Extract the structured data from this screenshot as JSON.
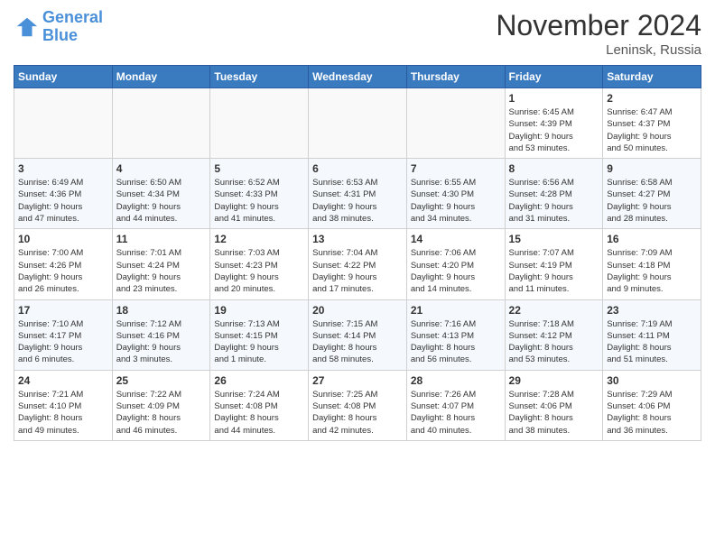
{
  "logo": {
    "line1": "General",
    "line2": "Blue"
  },
  "title": "November 2024",
  "location": "Leninsk, Russia",
  "days_of_week": [
    "Sunday",
    "Monday",
    "Tuesday",
    "Wednesday",
    "Thursday",
    "Friday",
    "Saturday"
  ],
  "weeks": [
    [
      {
        "day": "",
        "info": ""
      },
      {
        "day": "",
        "info": ""
      },
      {
        "day": "",
        "info": ""
      },
      {
        "day": "",
        "info": ""
      },
      {
        "day": "",
        "info": ""
      },
      {
        "day": "1",
        "info": "Sunrise: 6:45 AM\nSunset: 4:39 PM\nDaylight: 9 hours\nand 53 minutes."
      },
      {
        "day": "2",
        "info": "Sunrise: 6:47 AM\nSunset: 4:37 PM\nDaylight: 9 hours\nand 50 minutes."
      }
    ],
    [
      {
        "day": "3",
        "info": "Sunrise: 6:49 AM\nSunset: 4:36 PM\nDaylight: 9 hours\nand 47 minutes."
      },
      {
        "day": "4",
        "info": "Sunrise: 6:50 AM\nSunset: 4:34 PM\nDaylight: 9 hours\nand 44 minutes."
      },
      {
        "day": "5",
        "info": "Sunrise: 6:52 AM\nSunset: 4:33 PM\nDaylight: 9 hours\nand 41 minutes."
      },
      {
        "day": "6",
        "info": "Sunrise: 6:53 AM\nSunset: 4:31 PM\nDaylight: 9 hours\nand 38 minutes."
      },
      {
        "day": "7",
        "info": "Sunrise: 6:55 AM\nSunset: 4:30 PM\nDaylight: 9 hours\nand 34 minutes."
      },
      {
        "day": "8",
        "info": "Sunrise: 6:56 AM\nSunset: 4:28 PM\nDaylight: 9 hours\nand 31 minutes."
      },
      {
        "day": "9",
        "info": "Sunrise: 6:58 AM\nSunset: 4:27 PM\nDaylight: 9 hours\nand 28 minutes."
      }
    ],
    [
      {
        "day": "10",
        "info": "Sunrise: 7:00 AM\nSunset: 4:26 PM\nDaylight: 9 hours\nand 26 minutes."
      },
      {
        "day": "11",
        "info": "Sunrise: 7:01 AM\nSunset: 4:24 PM\nDaylight: 9 hours\nand 23 minutes."
      },
      {
        "day": "12",
        "info": "Sunrise: 7:03 AM\nSunset: 4:23 PM\nDaylight: 9 hours\nand 20 minutes."
      },
      {
        "day": "13",
        "info": "Sunrise: 7:04 AM\nSunset: 4:22 PM\nDaylight: 9 hours\nand 17 minutes."
      },
      {
        "day": "14",
        "info": "Sunrise: 7:06 AM\nSunset: 4:20 PM\nDaylight: 9 hours\nand 14 minutes."
      },
      {
        "day": "15",
        "info": "Sunrise: 7:07 AM\nSunset: 4:19 PM\nDaylight: 9 hours\nand 11 minutes."
      },
      {
        "day": "16",
        "info": "Sunrise: 7:09 AM\nSunset: 4:18 PM\nDaylight: 9 hours\nand 9 minutes."
      }
    ],
    [
      {
        "day": "17",
        "info": "Sunrise: 7:10 AM\nSunset: 4:17 PM\nDaylight: 9 hours\nand 6 minutes."
      },
      {
        "day": "18",
        "info": "Sunrise: 7:12 AM\nSunset: 4:16 PM\nDaylight: 9 hours\nand 3 minutes."
      },
      {
        "day": "19",
        "info": "Sunrise: 7:13 AM\nSunset: 4:15 PM\nDaylight: 9 hours\nand 1 minute."
      },
      {
        "day": "20",
        "info": "Sunrise: 7:15 AM\nSunset: 4:14 PM\nDaylight: 8 hours\nand 58 minutes."
      },
      {
        "day": "21",
        "info": "Sunrise: 7:16 AM\nSunset: 4:13 PM\nDaylight: 8 hours\nand 56 minutes."
      },
      {
        "day": "22",
        "info": "Sunrise: 7:18 AM\nSunset: 4:12 PM\nDaylight: 8 hours\nand 53 minutes."
      },
      {
        "day": "23",
        "info": "Sunrise: 7:19 AM\nSunset: 4:11 PM\nDaylight: 8 hours\nand 51 minutes."
      }
    ],
    [
      {
        "day": "24",
        "info": "Sunrise: 7:21 AM\nSunset: 4:10 PM\nDaylight: 8 hours\nand 49 minutes."
      },
      {
        "day": "25",
        "info": "Sunrise: 7:22 AM\nSunset: 4:09 PM\nDaylight: 8 hours\nand 46 minutes."
      },
      {
        "day": "26",
        "info": "Sunrise: 7:24 AM\nSunset: 4:08 PM\nDaylight: 8 hours\nand 44 minutes."
      },
      {
        "day": "27",
        "info": "Sunrise: 7:25 AM\nSunset: 4:08 PM\nDaylight: 8 hours\nand 42 minutes."
      },
      {
        "day": "28",
        "info": "Sunrise: 7:26 AM\nSunset: 4:07 PM\nDaylight: 8 hours\nand 40 minutes."
      },
      {
        "day": "29",
        "info": "Sunrise: 7:28 AM\nSunset: 4:06 PM\nDaylight: 8 hours\nand 38 minutes."
      },
      {
        "day": "30",
        "info": "Sunrise: 7:29 AM\nSunset: 4:06 PM\nDaylight: 8 hours\nand 36 minutes."
      }
    ]
  ]
}
